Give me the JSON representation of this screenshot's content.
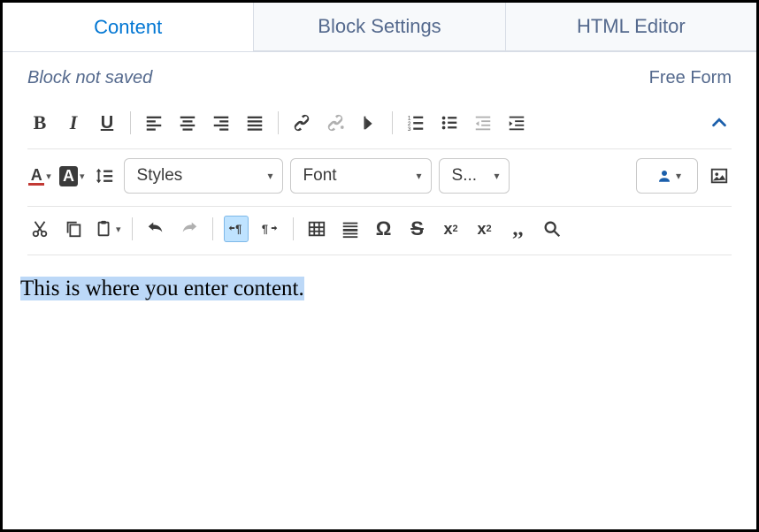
{
  "tabs": {
    "content": "Content",
    "block_settings": "Block Settings",
    "html_editor": "HTML Editor"
  },
  "status": {
    "not_saved": "Block not saved",
    "layout": "Free Form"
  },
  "dropdowns": {
    "styles": "Styles",
    "font": "Font",
    "size": "S..."
  },
  "editor": {
    "text": "This is where you enter content."
  }
}
